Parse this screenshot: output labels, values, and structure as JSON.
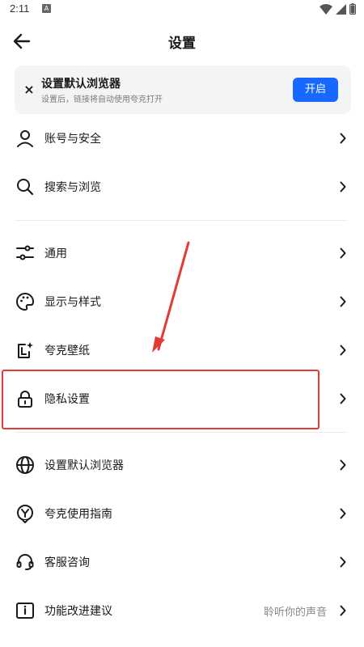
{
  "status_bar": {
    "time": "2:11",
    "notification_badge": "A",
    "icons": [
      "wifi-icon",
      "signal-icon",
      "battery-icon"
    ]
  },
  "header": {
    "title": "设置",
    "back_icon": "arrow-left-icon"
  },
  "banner": {
    "title": "设置默认浏览器",
    "subtitle": "设置后，链接将自动使用夸克打开",
    "button_label": "开启",
    "close_icon": "close-icon",
    "button_color": "#1668ff"
  },
  "menu": {
    "account": {
      "label": "账号与安全",
      "icon": "user-icon"
    },
    "search": {
      "label": "搜索与浏览",
      "icon": "search-icon"
    },
    "general": {
      "label": "通用",
      "icon": "sliders-icon"
    },
    "display": {
      "label": "显示与样式",
      "icon": "palette-icon"
    },
    "wallpaper": {
      "label": "夸克壁纸",
      "icon": "wallpaper-icon"
    },
    "privacy": {
      "label": "隐私设置",
      "icon": "lock-icon"
    },
    "default_browser": {
      "label": "设置默认浏览器",
      "icon": "globe-icon"
    },
    "guide": {
      "label": "夸克使用指南",
      "icon": "guide-icon"
    },
    "support": {
      "label": "客服咨询",
      "icon": "headset-icon"
    },
    "feedback": {
      "label": "功能改进建议",
      "icon": "feedback-icon",
      "extra": "聆听你的声音"
    }
  },
  "annotation": {
    "highlight_color": "#e53935"
  }
}
